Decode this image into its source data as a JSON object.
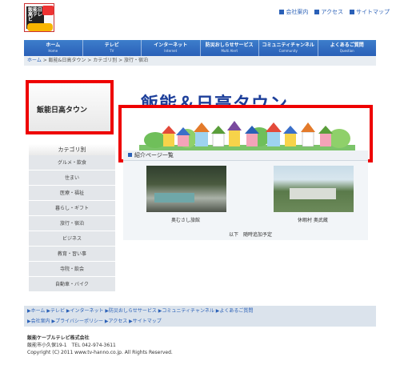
{
  "header": {
    "logo_text": "飯能日高テレビ",
    "top_links": [
      "会社案内",
      "アクセス",
      "サイトマップ"
    ]
  },
  "nav": [
    {
      "jp": "ホーム",
      "en": "Home"
    },
    {
      "jp": "テレビ",
      "en": "TV"
    },
    {
      "jp": "インターネット",
      "en": "Internet"
    },
    {
      "jp": "防災おしらせサービス",
      "en": "Multi Alert"
    },
    {
      "jp": "コミュニティチャンネル",
      "en": "Community"
    },
    {
      "jp": "よくあるご質問",
      "en": "Question"
    }
  ],
  "breadcrumb": {
    "home": "ホーム",
    "rest": " > 飯能&日高タウン > カテゴリ別 > 旅行・宿泊"
  },
  "sidebar": {
    "banner_label": "飯能日高タウン",
    "category_heading": "カテゴリ別",
    "categories": [
      "グルメ・飲食",
      "住まい",
      "医療・福祉",
      "暮らし・ギフト",
      "旅行・宿泊",
      "ビジネス",
      "教育・習い事",
      "寺院・飲会",
      "自動車・バイク"
    ]
  },
  "main": {
    "title": "飯能＆日高タウン",
    "intro_heading": "紹介ページ一覧",
    "entries": [
      {
        "caption": "奥むさし旅館"
      },
      {
        "caption": "休暇村 奥武蔵"
      }
    ],
    "more_text": "以下　随時追加予定"
  },
  "footer": {
    "nav_row1": "▶ホーム ▶テレビ ▶インターネット ▶防災おしらせサービス ▶コミュニティチャンネル ▶よくあるご質問",
    "nav_row2": "▶会社案内 ▶プライバシーポリシー ▶アクセス ▶サイトマップ",
    "company_name": "飯能ケーブルテレビ株式会社",
    "address": "飯能市小久保19-1　TEL 042-974-3611",
    "copyright": "Copyright (C) 2011 www.tv-hanno.co.jp. All Rights Reserved."
  },
  "colors": {
    "nav_blue": "#2a60b7",
    "title_blue": "#1d3f9a",
    "highlight_red": "#ee0000"
  }
}
